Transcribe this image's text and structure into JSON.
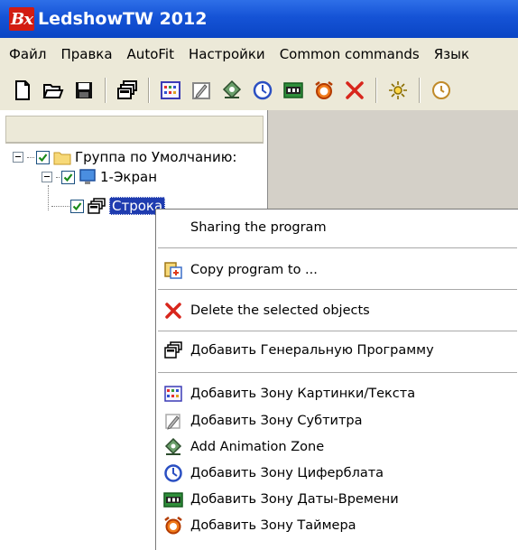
{
  "window": {
    "logo_text": "Bx",
    "title": "LedshowTW 2012"
  },
  "menubar": {
    "items": [
      {
        "label": "Файл"
      },
      {
        "label": "Правка"
      },
      {
        "label": "AutoFit"
      },
      {
        "label": "Настройки"
      },
      {
        "label": "Common commands"
      },
      {
        "label": "Язык"
      }
    ]
  },
  "toolbar": {
    "buttons": [
      {
        "icon": "new-file-icon"
      },
      {
        "icon": "open-folder-icon"
      },
      {
        "icon": "save-icon"
      },
      {
        "icon": "program-icon"
      },
      {
        "icon": "picture-text-zone-icon"
      },
      {
        "icon": "subtitle-zone-icon"
      },
      {
        "icon": "animation-zone-icon"
      },
      {
        "icon": "clock-zone-icon"
      },
      {
        "icon": "date-time-zone-icon"
      },
      {
        "icon": "timer-zone-icon"
      },
      {
        "icon": "delete-icon"
      },
      {
        "icon": "brightness-icon"
      },
      {
        "icon": "schedule-icon"
      }
    ]
  },
  "tree": {
    "group_label": "Группа по Умолчанию:",
    "screen_label": "1-Экран",
    "program_label": "Строка"
  },
  "context_menu": {
    "items": [
      {
        "label": "Sharing the program",
        "icon": ""
      },
      {
        "label": "Copy program to ...",
        "icon": "copy-program-icon"
      },
      {
        "label": "Delete the selected objects",
        "icon": "delete-icon"
      },
      {
        "label": "Добавить Генеральную Программу",
        "icon": "program-icon"
      },
      {
        "label": "Добавить Зону Картинки/Текста",
        "icon": "picture-text-zone-icon"
      },
      {
        "label": "Добавить Зону Субтитра",
        "icon": "subtitle-zone-icon"
      },
      {
        "label": "Add Animation Zone",
        "icon": "animation-zone-icon"
      },
      {
        "label": "Добавить Зону Циферблата",
        "icon": "clock-zone-icon"
      },
      {
        "label": "Добавить Зону Даты-Времени",
        "icon": "date-time-zone-icon"
      },
      {
        "label": "Добавить Зону Таймера",
        "icon": "timer-zone-icon"
      }
    ]
  },
  "colors": {
    "titlebar": "#1553d6",
    "selection": "#1f3cb0",
    "chrome": "#ece9d8",
    "workspace": "#d4d0c8"
  }
}
